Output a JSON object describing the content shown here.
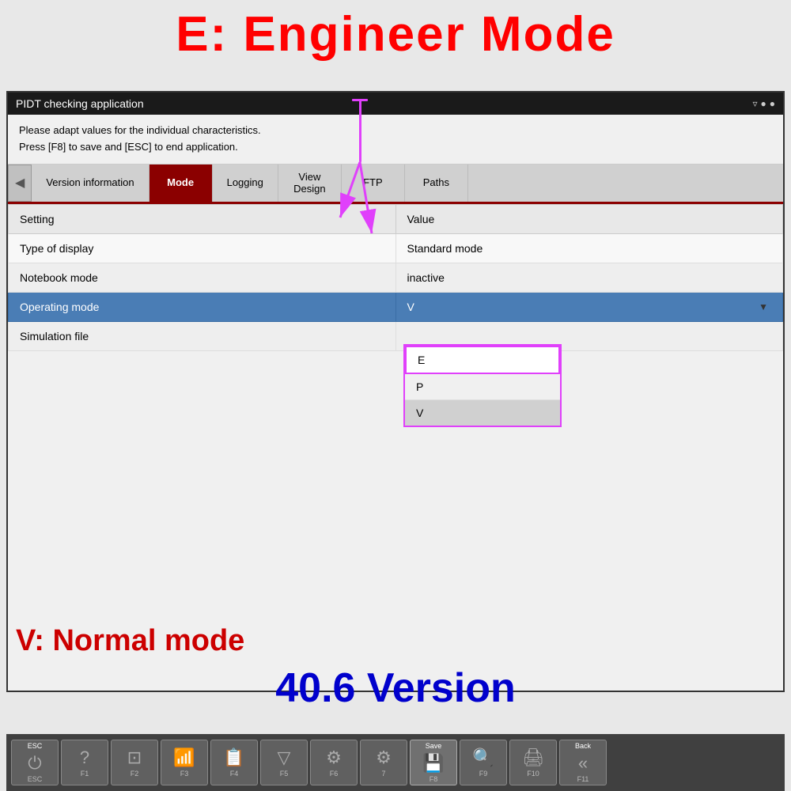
{
  "top_label": "E:   Engineer Mode",
  "app": {
    "title": "PIDT checking application",
    "instruction1": "Please adapt values for the individual characteristics.",
    "instruction2": "Press [F8] to save and [ESC] to end application."
  },
  "tabs": [
    {
      "id": "version",
      "label": "Version information",
      "active": false
    },
    {
      "id": "mode",
      "label": "Mode",
      "active": true
    },
    {
      "id": "logging",
      "label": "Logging",
      "active": false
    },
    {
      "id": "view-design",
      "label": "View\nDesign",
      "active": false
    },
    {
      "id": "ftp",
      "label": "FTP",
      "active": false
    },
    {
      "id": "paths",
      "label": "Paths",
      "active": false
    }
  ],
  "table": {
    "col_setting": "Setting",
    "col_value": "Value",
    "rows": [
      {
        "setting": "Type of display",
        "value": "Standard mode",
        "selected": false
      },
      {
        "setting": "Notebook mode",
        "value": "inactive",
        "selected": false
      },
      {
        "setting": "Operating mode",
        "value": "V",
        "selected": true,
        "has_dropdown": true
      },
      {
        "setting": "Simulation file",
        "value": "",
        "selected": false
      }
    ]
  },
  "dropdown": {
    "options": [
      {
        "label": "E",
        "highlighted": true
      },
      {
        "label": "P",
        "highlighted": false
      },
      {
        "label": "V",
        "highlighted": false
      }
    ]
  },
  "bottom_left_label": "V: Normal  mode",
  "bottom_center_label": "40.6 Version",
  "toolbar": {
    "buttons": [
      {
        "id": "esc",
        "top_label": "ESC",
        "icon": "⏻",
        "label": "ESC"
      },
      {
        "id": "f1",
        "top_label": "",
        "icon": "?",
        "label": "F1"
      },
      {
        "id": "f2",
        "top_label": "",
        "icon": "⊞",
        "label": "F2"
      },
      {
        "id": "f3",
        "top_label": "",
        "icon": "📊",
        "label": "F3"
      },
      {
        "id": "f4",
        "top_label": "",
        "icon": "📋",
        "label": "F4"
      },
      {
        "id": "f5",
        "top_label": "",
        "icon": "▽",
        "label": "F5"
      },
      {
        "id": "f6",
        "top_label": "",
        "icon": "⚙",
        "label": "F6"
      },
      {
        "id": "f7",
        "top_label": "",
        "icon": "⚙",
        "label": "7"
      },
      {
        "id": "f8",
        "top_label": "Save",
        "icon": "💾",
        "label": "F8"
      },
      {
        "id": "f9",
        "top_label": "",
        "icon": "🔍",
        "label": "F9"
      },
      {
        "id": "f10",
        "top_label": "",
        "icon": "🖨",
        "label": "F10"
      },
      {
        "id": "f11",
        "top_label": "Back",
        "icon": "«",
        "label": "F11"
      }
    ]
  }
}
